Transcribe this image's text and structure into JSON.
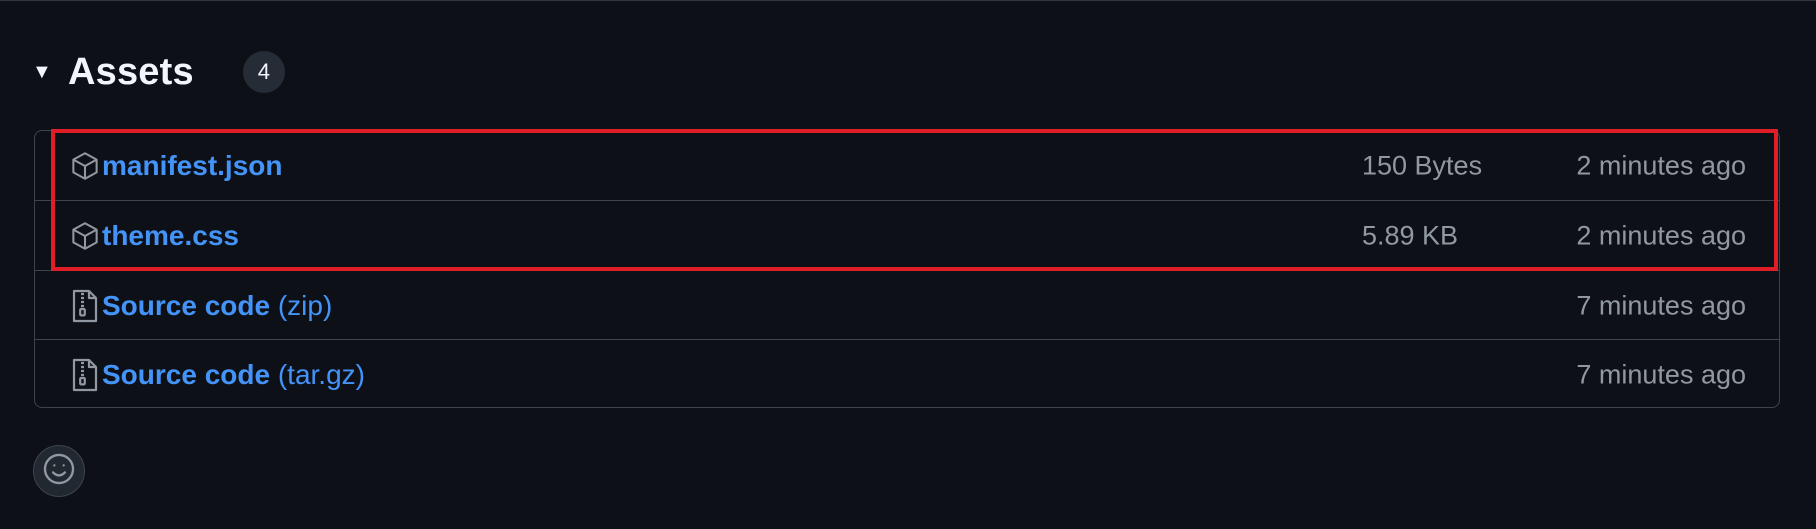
{
  "assets": {
    "toggle_glyph": "▼",
    "title": "Assets",
    "count": "4",
    "rows": [
      {
        "name": "manifest.json",
        "suffix": "",
        "size": "150 Bytes",
        "time": "2 minutes ago",
        "icon": "package-icon"
      },
      {
        "name": "theme.css",
        "suffix": "",
        "size": "5.89 KB",
        "time": "2 minutes ago",
        "icon": "package-icon"
      },
      {
        "name": "Source code",
        "suffix": " (zip)",
        "size": "",
        "time": "7 minutes ago",
        "icon": "file-zip-icon"
      },
      {
        "name": "Source code",
        "suffix": " (tar.gz)",
        "size": "",
        "time": "7 minutes ago",
        "icon": "file-zip-icon"
      }
    ]
  },
  "reactions": {
    "icon": "smiley-icon"
  },
  "colors": {
    "background": "#0d1117",
    "link": "#4493f8",
    "muted_text": "#9198a1",
    "border": "#3d444d",
    "highlight": "#e01e28"
  }
}
